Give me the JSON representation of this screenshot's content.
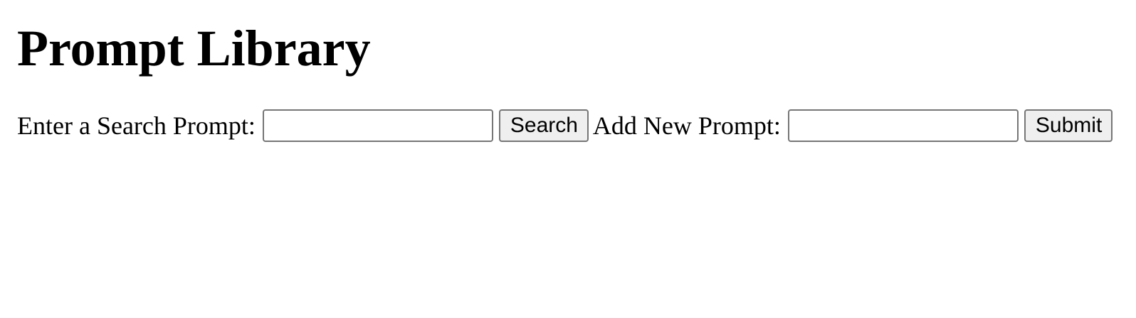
{
  "page": {
    "title": "Prompt Library"
  },
  "search": {
    "label": "Enter a Search Prompt:",
    "value": "",
    "placeholder": "",
    "button_label": "Search"
  },
  "add_prompt": {
    "label": "Add New Prompt:",
    "value": "",
    "placeholder": "",
    "button_label": "Submit"
  }
}
